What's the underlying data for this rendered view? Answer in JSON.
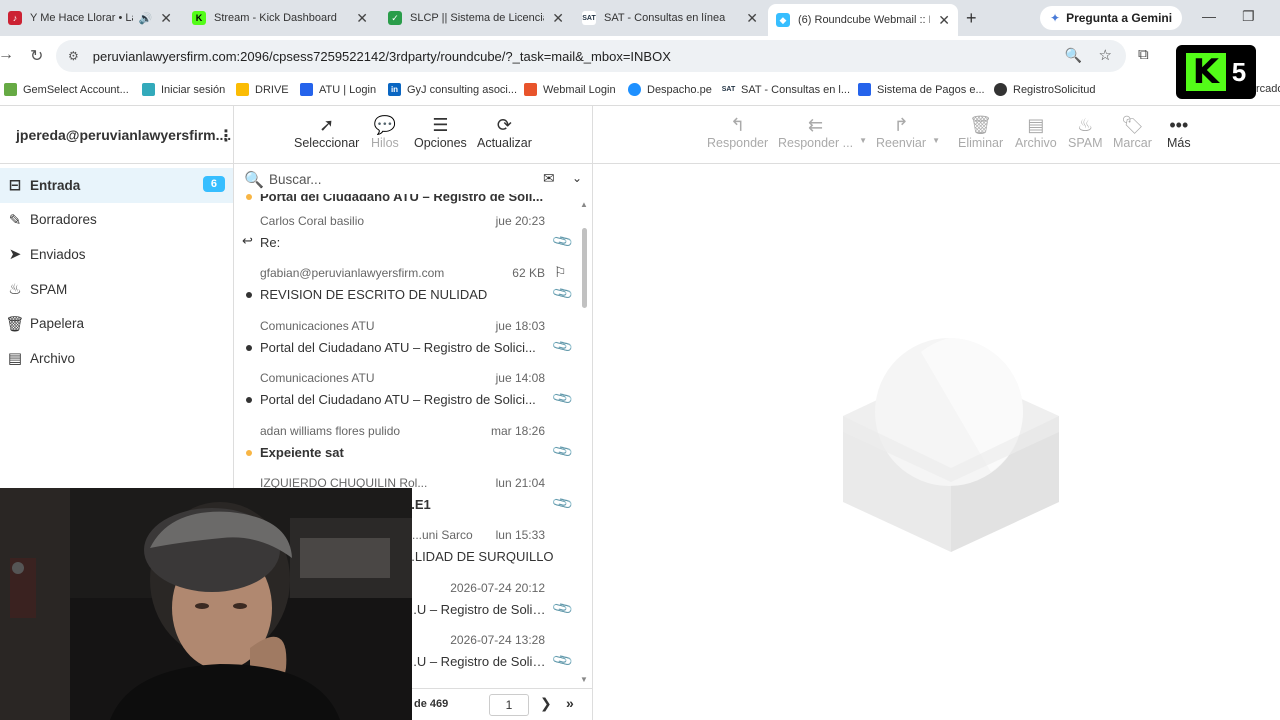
{
  "browser": {
    "tabs": [
      {
        "title": "Y Me Hace Llorar • La Ú",
        "icon": "music-icon",
        "color": "#c23",
        "audio": true
      },
      {
        "title": "Stream - Kick Dashboard",
        "icon": "kick-icon",
        "color": "#53fc18"
      },
      {
        "title": "SLCP || Sistema de Licencias",
        "icon": "shield-check-icon",
        "color": "#2a9d4a"
      },
      {
        "title": "SAT - Consultas en línea",
        "icon": "sat-icon",
        "color": "#234"
      },
      {
        "title": "(6) Roundcube Webmail :: En",
        "icon": "roundcube-icon",
        "color": "#37beff",
        "active": true
      }
    ],
    "new_tab": "+",
    "gemini_label": "Pregunta a Gemini",
    "url": "peruvianlawyersfirm.com:2096/cpsess7259522142/3rdparty/roundcube/?_task=mail&_mbox=INBOX",
    "bookmarks": [
      {
        "label": "GemSelect Account...",
        "color": "#6a4"
      },
      {
        "label": "Iniciar sesión",
        "color": "#3ab"
      },
      {
        "label": "DRIVE",
        "color": "#fbbc04"
      },
      {
        "label": "ATU | Login",
        "color": "#2563eb"
      },
      {
        "label": "GyJ consulting asoci...",
        "color": "#0a66c2"
      },
      {
        "label": "Webmail Login",
        "color": "#e8542b"
      },
      {
        "label": "Despacho.pe",
        "color": "#1e90ff"
      },
      {
        "label": "SAT - Consultas en l...",
        "color": "#234"
      },
      {
        "label": "Sistema de Pagos e...",
        "color": "#2563eb"
      },
      {
        "label": "RegistroSolicitud",
        "color": "#333"
      }
    ],
    "bookmark_overflow": "rcado"
  },
  "overlay": {
    "kick_number": "5"
  },
  "mail": {
    "account": "jpereda@peruvianlawyersfirm....",
    "folders": [
      {
        "label": "Entrada",
        "icon": "inbox-icon",
        "count": "6",
        "selected": true
      },
      {
        "label": "Borradores",
        "icon": "pencil-icon"
      },
      {
        "label": "Enviados",
        "icon": "send-icon"
      },
      {
        "label": "SPAM",
        "icon": "fire-icon"
      },
      {
        "label": "Papelera",
        "icon": "trash-icon"
      },
      {
        "label": "Archivo",
        "icon": "archive-icon"
      }
    ],
    "list_toolbar": {
      "select": "Seleccionar",
      "threads": "Hilos",
      "options": "Opciones",
      "refresh": "Actualizar"
    },
    "search_placeholder": "Buscar...",
    "top_partial_subject": "Portal del Ciudadano ATU – Registro de Soli...",
    "messages": [
      {
        "from": "Carlos Coral basilio",
        "date": "jue 20:23",
        "subject": "Re:",
        "replied": true,
        "attachment": true
      },
      {
        "from": "gfabian@peruvianlawyersfirm.com",
        "size": "62 KB",
        "subject": "REVISION DE ESCRITO DE NULIDAD",
        "flag": true,
        "attachment": true
      },
      {
        "from": "Comunicaciones ATU",
        "date": "jue 18:03",
        "subject": "Portal del Ciudadano ATU – Registro de Solici...",
        "attachment": true
      },
      {
        "from": "Comunicaciones ATU",
        "date": "jue 14:08",
        "subject": "Portal del Ciudadano ATU – Registro de Solici...",
        "attachment": true
      },
      {
        "from": "adan williams flores pulido",
        "date": "mar 18:26",
        "subject": "Expeiente sat",
        "unread": true,
        "attachment": true
      },
      {
        "from": "IZQUIERDO CHUQUILIN Rol...",
        "date": "lun 21:04",
        "subject": "...E1",
        "attachment": true
      },
      {
        "from": "...uni Sarco",
        "date": "lun 15:33",
        "subject": "...LIDAD DE SURQUILLO"
      },
      {
        "from": "",
        "date": "2026-07-24 20:12",
        "subject": "...U – Registro de Solici...",
        "attachment": true
      },
      {
        "from": "",
        "date": "2026-07-24 13:28",
        "subject": "...U – Registro de Solici...",
        "attachment": true
      }
    ],
    "pager": {
      "count_text": "de 469",
      "page": "1"
    },
    "message_toolbar": {
      "reply": "Responder",
      "reply_all": "Responder ...",
      "forward": "Reenviar",
      "delete": "Eliminar",
      "archive": "Archivo",
      "spam": "SPAM",
      "mark": "Marcar",
      "more": "Más"
    }
  }
}
